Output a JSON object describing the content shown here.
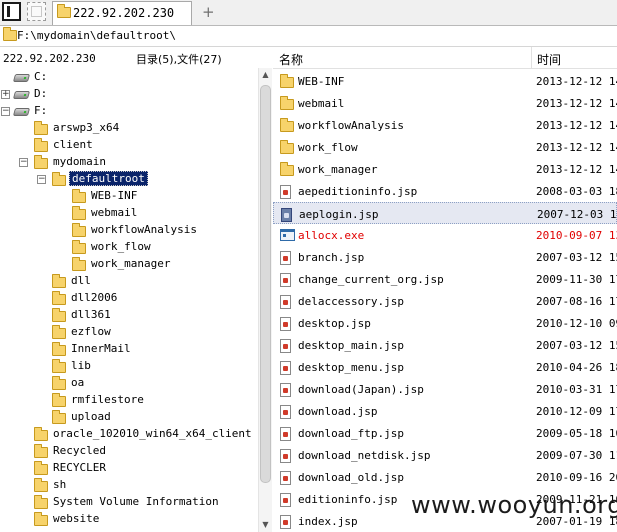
{
  "tab": {
    "label": "222.92.202.230"
  },
  "path": {
    "text": "F:\\mydomain\\defaultroot\\"
  },
  "left_header": {
    "host": "222.92.202.230",
    "count": "目录(5),文件(27)"
  },
  "tree": {
    "drives": [
      "C:",
      "D:",
      "F:"
    ],
    "f_children": [
      "arswp3_x64",
      "client"
    ],
    "mydomain": "mydomain",
    "defaultroot": "defaultroot",
    "defaultroot_children": [
      "WEB-INF",
      "webmail",
      "workflowAnalysis",
      "work_flow",
      "work_manager"
    ],
    "mydomain_children": [
      "dll",
      "dll2006",
      "dll361",
      "ezflow",
      "InnerMail",
      "lib",
      "oa",
      "rmfilestore",
      "upload"
    ],
    "f_more": [
      "oracle_102010_win64_x64_client",
      "Recycled",
      "RECYCLER",
      "sh",
      "System Volume Information",
      "website"
    ]
  },
  "columns": {
    "name": "名称",
    "time": "时间"
  },
  "files": [
    {
      "name": "WEB-INF",
      "date": "2013-12-12 14",
      "icon": "folder-icon"
    },
    {
      "name": "webmail",
      "date": "2013-12-12 14",
      "icon": "folder-icon"
    },
    {
      "name": "workflowAnalysis",
      "date": "2013-12-12 14",
      "icon": "folder-icon"
    },
    {
      "name": "work_flow",
      "date": "2013-12-12 14",
      "icon": "folder-icon"
    },
    {
      "name": "work_manager",
      "date": "2013-12-12 14",
      "icon": "folder-icon"
    },
    {
      "name": "aepeditioninfo.jsp",
      "date": "2008-03-03 18",
      "icon": "jsp-file-icon"
    },
    {
      "name": "aeplogin.jsp",
      "date": "2007-12-03 19",
      "icon": "jsp-file-icon"
    },
    {
      "name": "allocx.exe",
      "date": "2010-09-07 13",
      "icon": "exe-file-icon"
    },
    {
      "name": "branch.jsp",
      "date": "2007-03-12 15",
      "icon": "jsp-file-icon"
    },
    {
      "name": "change_current_org.jsp",
      "date": "2009-11-30 17",
      "icon": "jsp-file-icon"
    },
    {
      "name": "delaccessory.jsp",
      "date": "2007-08-16 17",
      "icon": "jsp-file-icon"
    },
    {
      "name": "desktop.jsp",
      "date": "2010-12-10 09",
      "icon": "jsp-file-icon"
    },
    {
      "name": "desktop_main.jsp",
      "date": "2007-03-12 15",
      "icon": "jsp-file-icon"
    },
    {
      "name": "desktop_menu.jsp",
      "date": "2010-04-26 18",
      "icon": "jsp-file-icon"
    },
    {
      "name": "download(Japan).jsp",
      "date": "2010-03-31 17",
      "icon": "jsp-file-icon"
    },
    {
      "name": "download.jsp",
      "date": "2010-12-09 17",
      "icon": "jsp-file-icon"
    },
    {
      "name": "download_ftp.jsp",
      "date": "2009-05-18 10",
      "icon": "jsp-file-icon"
    },
    {
      "name": "download_netdisk.jsp",
      "date": "2009-07-30 11",
      "icon": "jsp-file-icon"
    },
    {
      "name": "download_old.jsp",
      "date": "2010-09-16 20",
      "icon": "jsp-file-icon"
    },
    {
      "name": "editioninfo.jsp",
      "date": "2009-11-21 10",
      "icon": "jsp-file-icon"
    },
    {
      "name": "index.jsp",
      "date": "2007-01-19 18",
      "icon": "jsp-file-icon"
    }
  ],
  "watermark": "www.wooyun.org"
}
